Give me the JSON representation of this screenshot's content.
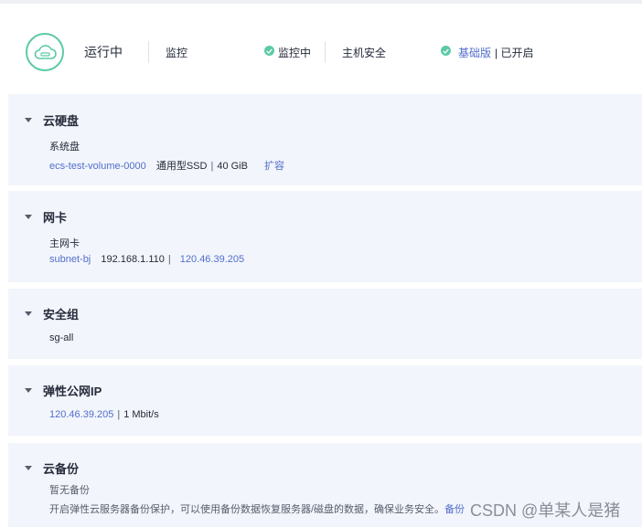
{
  "status": {
    "state": "运行中",
    "monitor_label": "监控",
    "monitor_status": "监控中",
    "security_label": "主机安全",
    "security_edition": "基础版",
    "security_status": "| 已开启"
  },
  "panels": {
    "disk": {
      "title": "云硬盘",
      "subtitle": "系统盘",
      "volume_name": "ecs-test-volume-0000",
      "volume_type": "通用型SSD",
      "size": "40 GiB",
      "expand_link": "扩容"
    },
    "nic": {
      "title": "网卡",
      "subtitle": "主网卡",
      "subnet": "subnet-bj",
      "private_ip": "192.168.1.110",
      "public_ip": "120.46.39.205"
    },
    "security_group": {
      "title": "安全组",
      "name": "sg-all"
    },
    "eip": {
      "title": "弹性公网IP",
      "ip": "120.46.39.205",
      "bandwidth": "1 Mbit/s"
    },
    "backup": {
      "title": "云备份",
      "status": "暂无备份",
      "hint": "开启弹性云服务器备份保护，可以使用备份数据恢复服务器/磁盘的数据，确保业务安全。",
      "backup_link": "备份"
    }
  },
  "common": {
    "separator": "|"
  },
  "watermark": "CSDN @单某人是猪",
  "colors": {
    "accent": "#526ecc",
    "ok": "#5ccaa5",
    "panel_bg": "#f2f5fb"
  }
}
